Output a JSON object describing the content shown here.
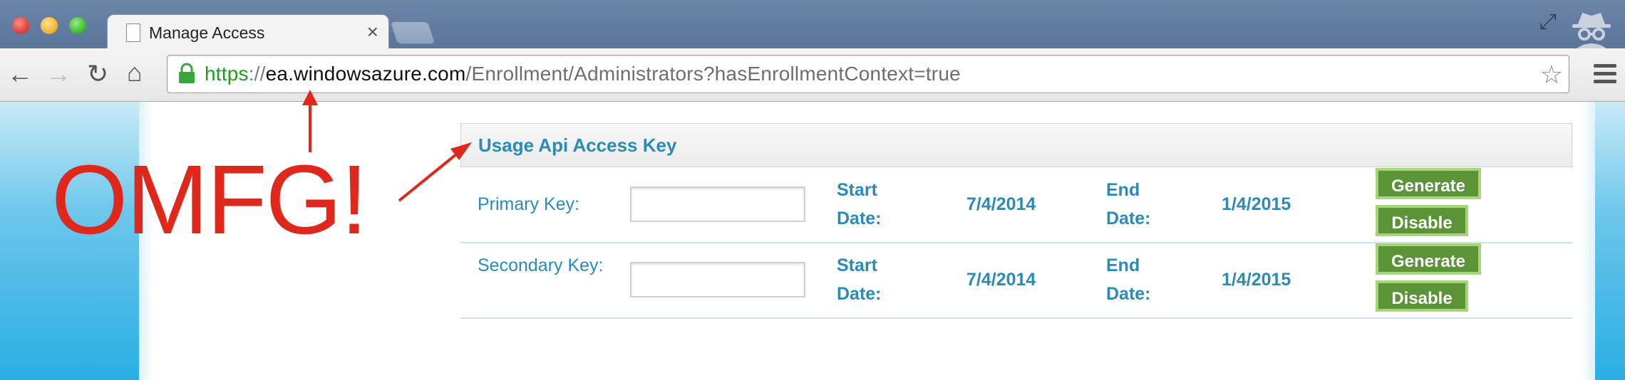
{
  "browser": {
    "tab_title": "Manage Access",
    "tab_close": "×",
    "url": {
      "scheme": "https",
      "separator": "://",
      "domain": "ea.windowsazure.com",
      "path": "/Enrollment/Administrators?hasEnrollmentContext=true"
    },
    "icons": {
      "back": "←",
      "forward": "→",
      "reload": "↻",
      "home": "⌂",
      "bookmark": "☆",
      "fullscreen": "⤢"
    }
  },
  "panel": {
    "title": "Usage Api Access Key",
    "rows": [
      {
        "label": "Primary Key:",
        "key_value": "",
        "start_label": "Start Date:",
        "start_value": "7/4/2014",
        "end_label": "End Date:",
        "end_value": "1/4/2015",
        "generate_label": "Generate",
        "disable_label": "Disable"
      },
      {
        "label": "Secondary Key:",
        "key_value": "",
        "start_label": "Start Date:",
        "start_value": "7/4/2014",
        "end_label": "End Date:",
        "end_value": "1/4/2015",
        "generate_label": "Generate",
        "disable_label": "Disable"
      }
    ]
  },
  "annotation": {
    "text": "OMFG!",
    "color": "#e0271b"
  },
  "colors": {
    "accent_text": "#2a8ab8",
    "button_green": "#5a9436",
    "button_border": "#a8d57c",
    "https_green": "#1c9d1c"
  }
}
